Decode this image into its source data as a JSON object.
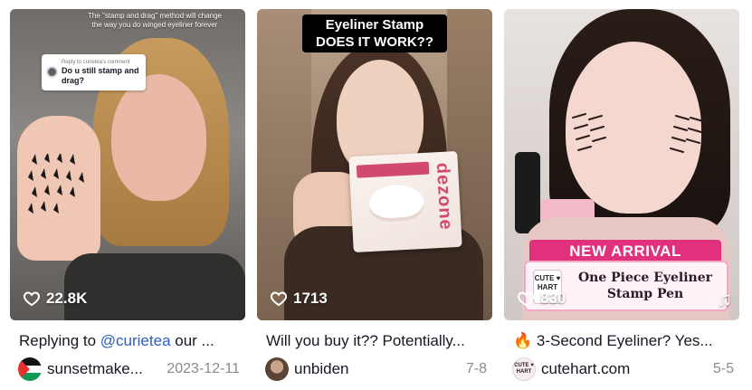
{
  "cards": [
    {
      "like_count": "22.8K",
      "overlay_caption": "The \"stamp and drag\" method will change the way you do winged eyeliner forever",
      "reply_header": "Reply to curietea's comment",
      "reply_text": "Do u still stamp and drag?",
      "title_prefix": "Replying to ",
      "title_mention": "@curietea",
      "title_suffix": " our ...",
      "author": "sunsetmake...",
      "date": "2023-12-11",
      "avatar_icon": "palestine-flag-icon"
    },
    {
      "like_count": "1713",
      "overlay_caption_line1": "Eyeliner Stamp",
      "overlay_caption_line2": "DOES IT WORK??",
      "product_brand": "dezone",
      "title": "Will you buy it?? Potentially...",
      "author": "unbiden",
      "date": "7-8",
      "avatar_icon": "user-photo-avatar"
    },
    {
      "like_count": "830",
      "promo_banner": "NEW ARRIVAL",
      "promo_logo": "CUTE ♥ HART",
      "promo_title": "One Piece Eyeliner Stamp Pen",
      "title_emoji": "🔥",
      "title": " 3-Second Eyeliner? Yes...",
      "author": "cutehart.com",
      "date": "5-5",
      "avatar_logo": "CUTE ♥ HART",
      "avatar_icon": "cutehart-logo-avatar"
    }
  ],
  "colors": {
    "text_primary": "#161823",
    "text_secondary": "#8a8b91",
    "mention": "#2b5db9",
    "promo_pink": "#e2317c"
  }
}
